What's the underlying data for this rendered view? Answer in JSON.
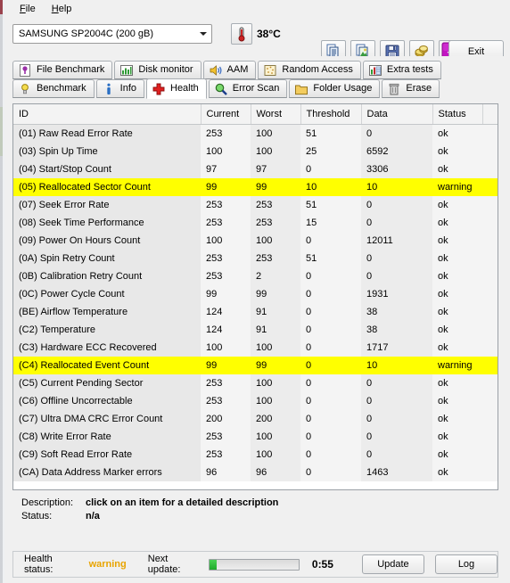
{
  "menu": {
    "items": [
      {
        "label": "File",
        "accel": "F"
      },
      {
        "label": "Help",
        "accel": "H"
      }
    ]
  },
  "toolbar": {
    "drive_selected": "SAMSUNG SP2004C (200 gB)",
    "temperature": "38°C",
    "temperature_icon": "thermometer-icon",
    "buttons": [
      {
        "name": "copy-to-clipboard-button",
        "icon": "copy-documents-icon"
      },
      {
        "name": "copy-image-button",
        "icon": "copy-image-icon"
      },
      {
        "name": "save-button",
        "icon": "floppy-disk-icon"
      },
      {
        "name": "tools-button",
        "icon": "gold-coins-icon"
      },
      {
        "name": "download-button",
        "icon": "download-arrow-icon"
      }
    ],
    "exit_label": "Exit"
  },
  "tabs": {
    "row1": [
      {
        "label": "File Benchmark",
        "icon": "file-benchmark-icon",
        "active": false
      },
      {
        "label": "Disk monitor",
        "icon": "bar-chart-icon",
        "active": false
      },
      {
        "label": "AAM",
        "icon": "speaker-icon",
        "active": false
      },
      {
        "label": "Random Access",
        "icon": "scatter-icon",
        "active": false
      },
      {
        "label": "Extra tests",
        "icon": "extra-tests-icon",
        "active": false
      }
    ],
    "row2": [
      {
        "label": "Benchmark",
        "icon": "lightbulb-icon",
        "active": false
      },
      {
        "label": "Info",
        "icon": "info-icon",
        "active": false
      },
      {
        "label": "Health",
        "icon": "red-cross-icon",
        "active": true
      },
      {
        "label": "Error Scan",
        "icon": "magnifier-icon",
        "active": false
      },
      {
        "label": "Folder Usage",
        "icon": "folder-icon",
        "active": false
      },
      {
        "label": "Erase",
        "icon": "trash-icon",
        "active": false
      }
    ]
  },
  "table": {
    "columns": [
      "ID",
      "Current",
      "Worst",
      "Threshold",
      "Data",
      "Status"
    ],
    "rows": [
      {
        "id": "(01) Raw Read Error Rate",
        "current": "253",
        "worst": "100",
        "threshold": "51",
        "data": "0",
        "status": "ok",
        "warn": false
      },
      {
        "id": "(03) Spin Up Time",
        "current": "100",
        "worst": "100",
        "threshold": "25",
        "data": "6592",
        "status": "ok",
        "warn": false
      },
      {
        "id": "(04) Start/Stop Count",
        "current": "97",
        "worst": "97",
        "threshold": "0",
        "data": "3306",
        "status": "ok",
        "warn": false
      },
      {
        "id": "(05) Reallocated Sector Count",
        "current": "99",
        "worst": "99",
        "threshold": "10",
        "data": "10",
        "status": "warning",
        "warn": true
      },
      {
        "id": "(07) Seek Error Rate",
        "current": "253",
        "worst": "253",
        "threshold": "51",
        "data": "0",
        "status": "ok",
        "warn": false
      },
      {
        "id": "(08) Seek Time Performance",
        "current": "253",
        "worst": "253",
        "threshold": "15",
        "data": "0",
        "status": "ok",
        "warn": false
      },
      {
        "id": "(09) Power On Hours Count",
        "current": "100",
        "worst": "100",
        "threshold": "0",
        "data": "12011",
        "status": "ok",
        "warn": false
      },
      {
        "id": "(0A) Spin Retry Count",
        "current": "253",
        "worst": "253",
        "threshold": "51",
        "data": "0",
        "status": "ok",
        "warn": false
      },
      {
        "id": "(0B) Calibration Retry Count",
        "current": "253",
        "worst": "2",
        "threshold": "0",
        "data": "0",
        "status": "ok",
        "warn": false
      },
      {
        "id": "(0C) Power Cycle Count",
        "current": "99",
        "worst": "99",
        "threshold": "0",
        "data": "1931",
        "status": "ok",
        "warn": false
      },
      {
        "id": "(BE) Airflow Temperature",
        "current": "124",
        "worst": "91",
        "threshold": "0",
        "data": "38",
        "status": "ok",
        "warn": false
      },
      {
        "id": "(C2) Temperature",
        "current": "124",
        "worst": "91",
        "threshold": "0",
        "data": "38",
        "status": "ok",
        "warn": false
      },
      {
        "id": "(C3) Hardware ECC Recovered",
        "current": "100",
        "worst": "100",
        "threshold": "0",
        "data": "1717",
        "status": "ok",
        "warn": false
      },
      {
        "id": "(C4) Reallocated Event Count",
        "current": "99",
        "worst": "99",
        "threshold": "0",
        "data": "10",
        "status": "warning",
        "warn": true
      },
      {
        "id": "(C5) Current Pending Sector",
        "current": "253",
        "worst": "100",
        "threshold": "0",
        "data": "0",
        "status": "ok",
        "warn": false
      },
      {
        "id": "(C6) Offline Uncorrectable",
        "current": "253",
        "worst": "100",
        "threshold": "0",
        "data": "0",
        "status": "ok",
        "warn": false
      },
      {
        "id": "(C7) Ultra DMA CRC Error Count",
        "current": "200",
        "worst": "200",
        "threshold": "0",
        "data": "0",
        "status": "ok",
        "warn": false
      },
      {
        "id": "(C8) Write Error Rate",
        "current": "253",
        "worst": "100",
        "threshold": "0",
        "data": "0",
        "status": "ok",
        "warn": false
      },
      {
        "id": "(C9) Soft Read Error Rate",
        "current": "253",
        "worst": "100",
        "threshold": "0",
        "data": "0",
        "status": "ok",
        "warn": false
      },
      {
        "id": "(CA) Data Address Marker errors",
        "current": "96",
        "worst": "96",
        "threshold": "0",
        "data": "1463",
        "status": "ok",
        "warn": false
      }
    ]
  },
  "description": {
    "desc_label": "Description:",
    "desc_value": "click on an item for a detailed description",
    "status_label": "Status:",
    "status_value": "n/a"
  },
  "statusbar": {
    "health_label": "Health status:",
    "health_value": "warning",
    "health_color": "#e8a400",
    "next_label": "Next update:",
    "progress_percent": 8,
    "time_remaining": "0:55",
    "update_label": "Update",
    "log_label": "Log"
  }
}
